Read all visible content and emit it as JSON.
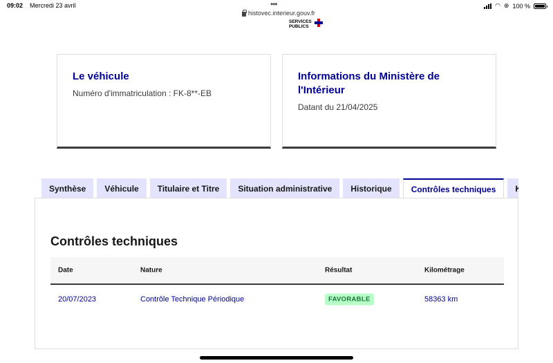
{
  "status_bar": {
    "time": "09:02",
    "date": "Mercredi 23 avril",
    "url": "histovec.interieur.gouv.fr",
    "battery": "100 %",
    "battery_level": 1.0
  },
  "logo": {
    "line1": "SERVICES",
    "line2": "PUBLICS"
  },
  "cards": [
    {
      "title": "Le véhicule",
      "text": "Numéro d'immatriculation : FK-8**-EB"
    },
    {
      "title": "Informations du Ministère de l'Intérieur",
      "text": "Datant du 21/04/2025"
    }
  ],
  "tabs": [
    {
      "label": "Synthèse"
    },
    {
      "label": "Véhicule"
    },
    {
      "label": "Titulaire et Titre"
    },
    {
      "label": "Situation administrative"
    },
    {
      "label": "Historique"
    },
    {
      "label": "Contrôles techniques",
      "active": true
    },
    {
      "label": "Kilométrage"
    }
  ],
  "panel": {
    "title": "Contrôles techniques",
    "headers": [
      "Date",
      "Nature",
      "Résultat",
      "Kilométrage"
    ],
    "rows": [
      {
        "date": "20/07/2023",
        "nature": "Contrôle Technique Périodique",
        "result": "FAVORABLE",
        "km": "58363 km"
      }
    ]
  },
  "colors": {
    "primary": "#000091",
    "tab_bg": "#e3e3fd",
    "badge_bg": "#b8fec9",
    "badge_text": "#18753c"
  }
}
